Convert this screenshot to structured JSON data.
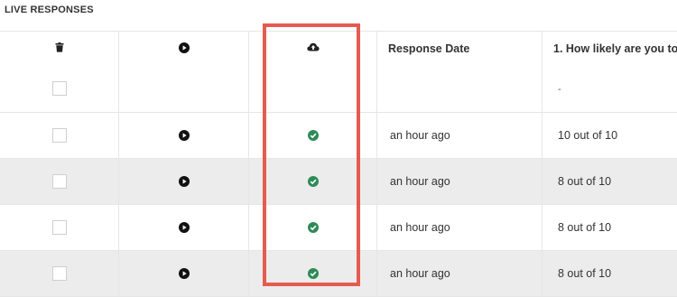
{
  "panel": {
    "title": "LIVE RESPONSES"
  },
  "columns": {
    "delete_icon": "trash-icon",
    "play_icon": "play-circle-icon",
    "upload_icon": "cloud-upload-icon",
    "response_date": "Response Date",
    "question_1": "1. How likely are you to",
    "question_1_value": "-"
  },
  "rows": [
    {
      "date": "an hour ago",
      "answer": "10 out of 10",
      "status_icon": "check-circle-icon"
    },
    {
      "date": "an hour ago",
      "answer": "8 out of 10",
      "status_icon": "check-circle-icon"
    },
    {
      "date": "an hour ago",
      "answer": "8 out of 10",
      "status_icon": "check-circle-icon"
    },
    {
      "date": "an hour ago",
      "answer": "8 out of 10",
      "status_icon": "check-circle-icon"
    }
  ],
  "colors": {
    "highlight": "#e45b4f",
    "check": "#2e8b57",
    "alt_row": "#ececec"
  }
}
